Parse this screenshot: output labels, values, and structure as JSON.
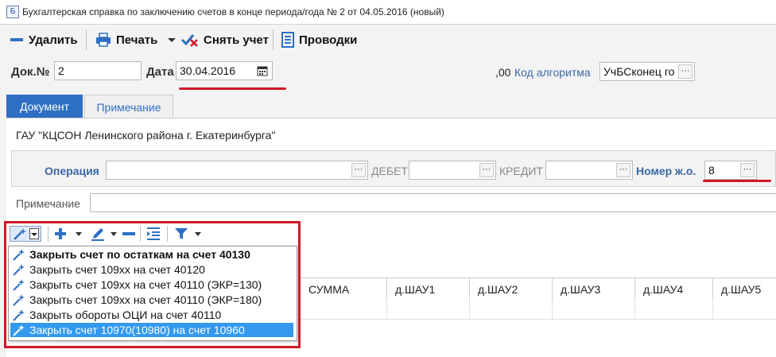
{
  "window": {
    "title": "Бухгалтерская справка по заключению счетов в конце периода/года № 2 от 04.05.2016 (новый)"
  },
  "toolbar": {
    "delete_label": "Удалить",
    "print_label": "Печать",
    "unpost_label": "Снять учет",
    "postings_label": "Проводки"
  },
  "header": {
    "docno_label": "Док.№",
    "docno_value": "2",
    "date_label": "Дата",
    "date_value": "30.04.2016",
    "amount_text": ",00",
    "algo_label": "Код алгоритма",
    "algo_value": "УчБСконец го"
  },
  "tabs": [
    {
      "label": "Документ"
    },
    {
      "label": "Примечание"
    }
  ],
  "document": {
    "org_name": "ГАУ \"КЦСОН Ленинского района г. Екатеринбурга\"",
    "operation_label": "Операция",
    "operation_value": "",
    "debit_label": "ДЕБЕТ",
    "debit_value": "",
    "credit_label": "КРЕДИТ",
    "credit_value": "",
    "journal_label": "Номер ж.о.",
    "journal_value": "8",
    "note_label": "Примечание",
    "note_value": ""
  },
  "menu": {
    "items": [
      {
        "label": "Закрыть счет по остаткам на счет 40130"
      },
      {
        "label": "Закрыть счет 109xx на счет 40120"
      },
      {
        "label": "Закрыть счет 109xx на счет 40110 (ЭКР=130)"
      },
      {
        "label": "Закрыть счет 109xx на счет 40110 (ЭКР=180)"
      },
      {
        "label": "Закрыть обороты ОЦИ на счет 40110"
      },
      {
        "label": "Закрыть счет 10970(10980) на счет 10960"
      }
    ]
  },
  "grid": {
    "columns": [
      "СУММА",
      "д.ШАУ1",
      "д.ШАУ2",
      "д.ШАУ3",
      "д.ШАУ4",
      "д.ШАУ5"
    ]
  },
  "colors": {
    "accent": "#2e6fc4",
    "highlight_red": "#d0182a",
    "link_blue": "#3a68a8",
    "selection": "#3399ee"
  }
}
